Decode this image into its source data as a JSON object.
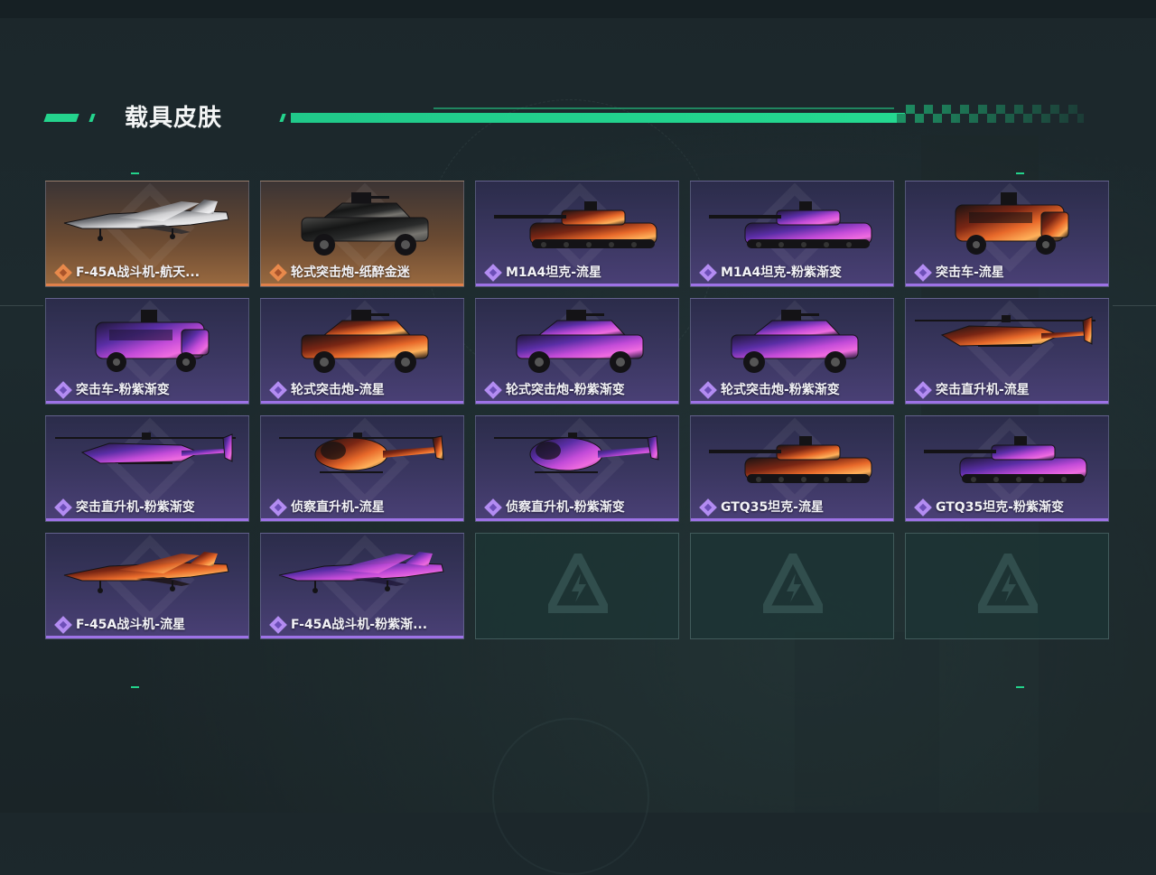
{
  "section_title": "载具皮肤",
  "colors": {
    "accent": "#24d48d",
    "rarity_purple": "#9d72e6",
    "rarity_gold": "#e0804a"
  },
  "skins": [
    {
      "name": "F-45A战斗机-航天...",
      "rarity": "gold",
      "vehicle": "jet",
      "skin": "silver"
    },
    {
      "name": "轮式突击炮-纸醉金迷",
      "rarity": "gold",
      "vehicle": "armored-car",
      "skin": "black"
    },
    {
      "name": "M1A4坦克-流星",
      "rarity": "purple",
      "vehicle": "tank",
      "skin": "meteor"
    },
    {
      "name": "M1A4坦克-粉紫渐变",
      "rarity": "purple",
      "vehicle": "tank",
      "skin": "gradient"
    },
    {
      "name": "突击车-流星",
      "rarity": "purple",
      "vehicle": "assault-truck",
      "skin": "meteor"
    },
    {
      "name": "突击车-粉紫渐变",
      "rarity": "purple",
      "vehicle": "assault-truck",
      "skin": "gradient"
    },
    {
      "name": "轮式突击炮-流星",
      "rarity": "purple",
      "vehicle": "armored-car",
      "skin": "meteor"
    },
    {
      "name": "轮式突击炮-粉紫渐变",
      "rarity": "purple",
      "vehicle": "armored-car",
      "skin": "gradient"
    },
    {
      "name": "轮式突击炮-粉紫渐变",
      "rarity": "purple",
      "vehicle": "armored-car",
      "skin": "gradient"
    },
    {
      "name": "突击直升机-流星",
      "rarity": "purple",
      "vehicle": "attack-heli",
      "skin": "meteor"
    },
    {
      "name": "突击直升机-粉紫渐变",
      "rarity": "purple",
      "vehicle": "attack-heli",
      "skin": "gradient"
    },
    {
      "name": "侦察直升机-流星",
      "rarity": "purple",
      "vehicle": "scout-heli",
      "skin": "meteor"
    },
    {
      "name": "侦察直升机-粉紫渐变",
      "rarity": "purple",
      "vehicle": "scout-heli",
      "skin": "gradient"
    },
    {
      "name": "GTQ35坦克-流星",
      "rarity": "purple",
      "vehicle": "tank",
      "skin": "meteor"
    },
    {
      "name": "GTQ35坦克-粉紫渐变",
      "rarity": "purple",
      "vehicle": "tank",
      "skin": "gradient"
    },
    {
      "name": "F-45A战斗机-流星",
      "rarity": "purple",
      "vehicle": "jet",
      "skin": "meteor"
    },
    {
      "name": "F-45A战斗机-粉紫渐...",
      "rarity": "purple",
      "vehicle": "jet",
      "skin": "gradient"
    }
  ],
  "empty_slot_count": 3
}
